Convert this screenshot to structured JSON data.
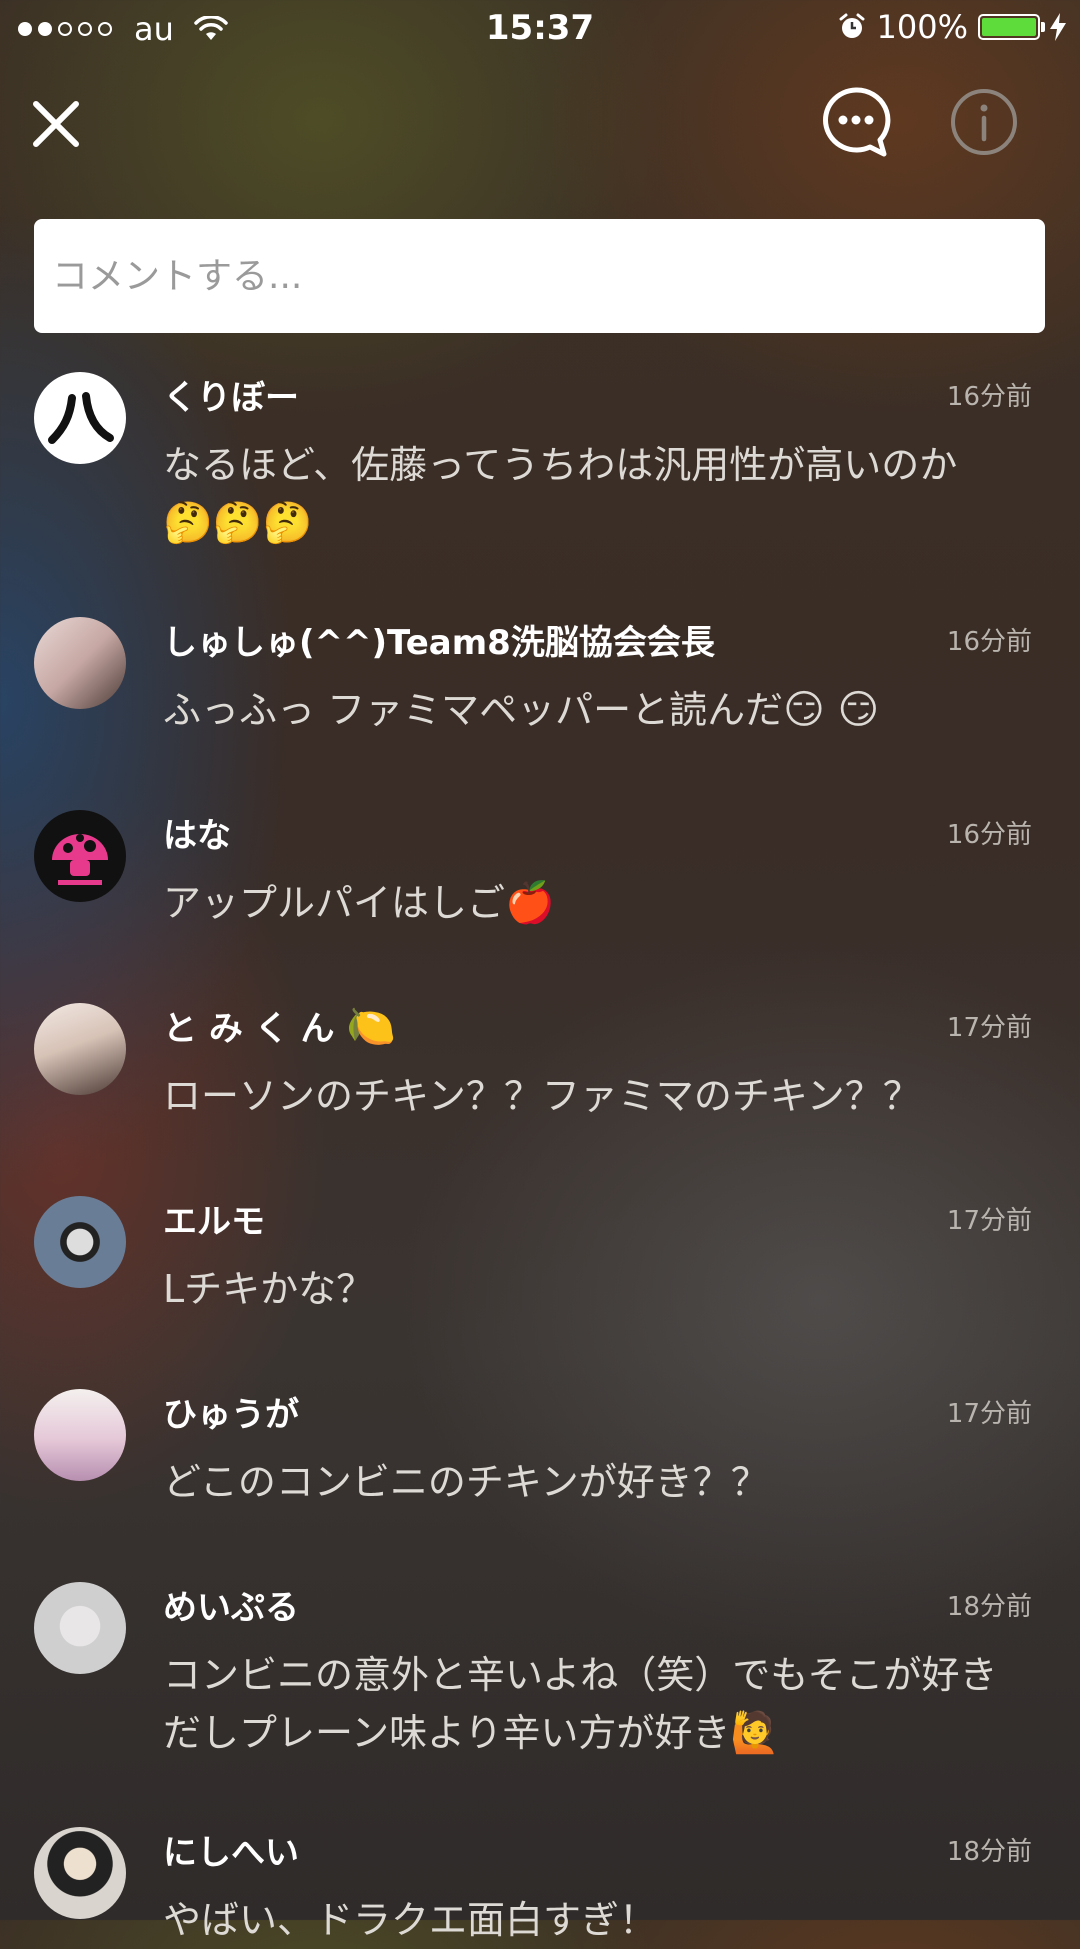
{
  "status_bar": {
    "signal_dots_filled": 2,
    "signal_dots_total": 5,
    "carrier": "au",
    "time": "15:37",
    "battery": "100%",
    "battery_color": "#5ddc3c"
  },
  "toolbar": {
    "close_icon": "close-icon",
    "chat_icon": "chat-bubble-icon",
    "info_icon": "info-icon"
  },
  "comment_input": {
    "placeholder": "コメントする...",
    "value": ""
  },
  "comments": [
    {
      "name": "くりぼー",
      "time": "16分前",
      "text": "なるほど、佐藤ってうちわは汎用性が高いのか",
      "emoji": "🤔🤔🤔"
    },
    {
      "name": "しゅしゅ(^^)Team8洗脳協会会長",
      "time": "16分前",
      "text": "ふっふっ  ファミマペッパーと読んだ",
      "emoji": "😏 😏"
    },
    {
      "name": "はな",
      "time": "16分前",
      "text": "アップルパイはしご",
      "emoji": "🍎"
    },
    {
      "name": "と み く ん",
      "name_emoji": "🍋",
      "time": "17分前",
      "text": "ローソンのチキン？？ファミマのチキン？？",
      "emoji": ""
    },
    {
      "name": "エルモ",
      "time": "17分前",
      "text": "Lチキかな？",
      "emoji": ""
    },
    {
      "name": "ひゅうが",
      "time": "17分前",
      "text": "どこのコンビニのチキンが好き？？",
      "emoji": ""
    },
    {
      "name": "めいぷる",
      "time": "18分前",
      "text": "コンビニの意外と辛いよね（笑）でもそこが好きだしプレーン味より辛い方が好き",
      "emoji": "🙋"
    },
    {
      "name": "にしへい",
      "time": "18分前",
      "text": "やばい、ドラクエ面白すぎ！",
      "emoji": ""
    }
  ]
}
